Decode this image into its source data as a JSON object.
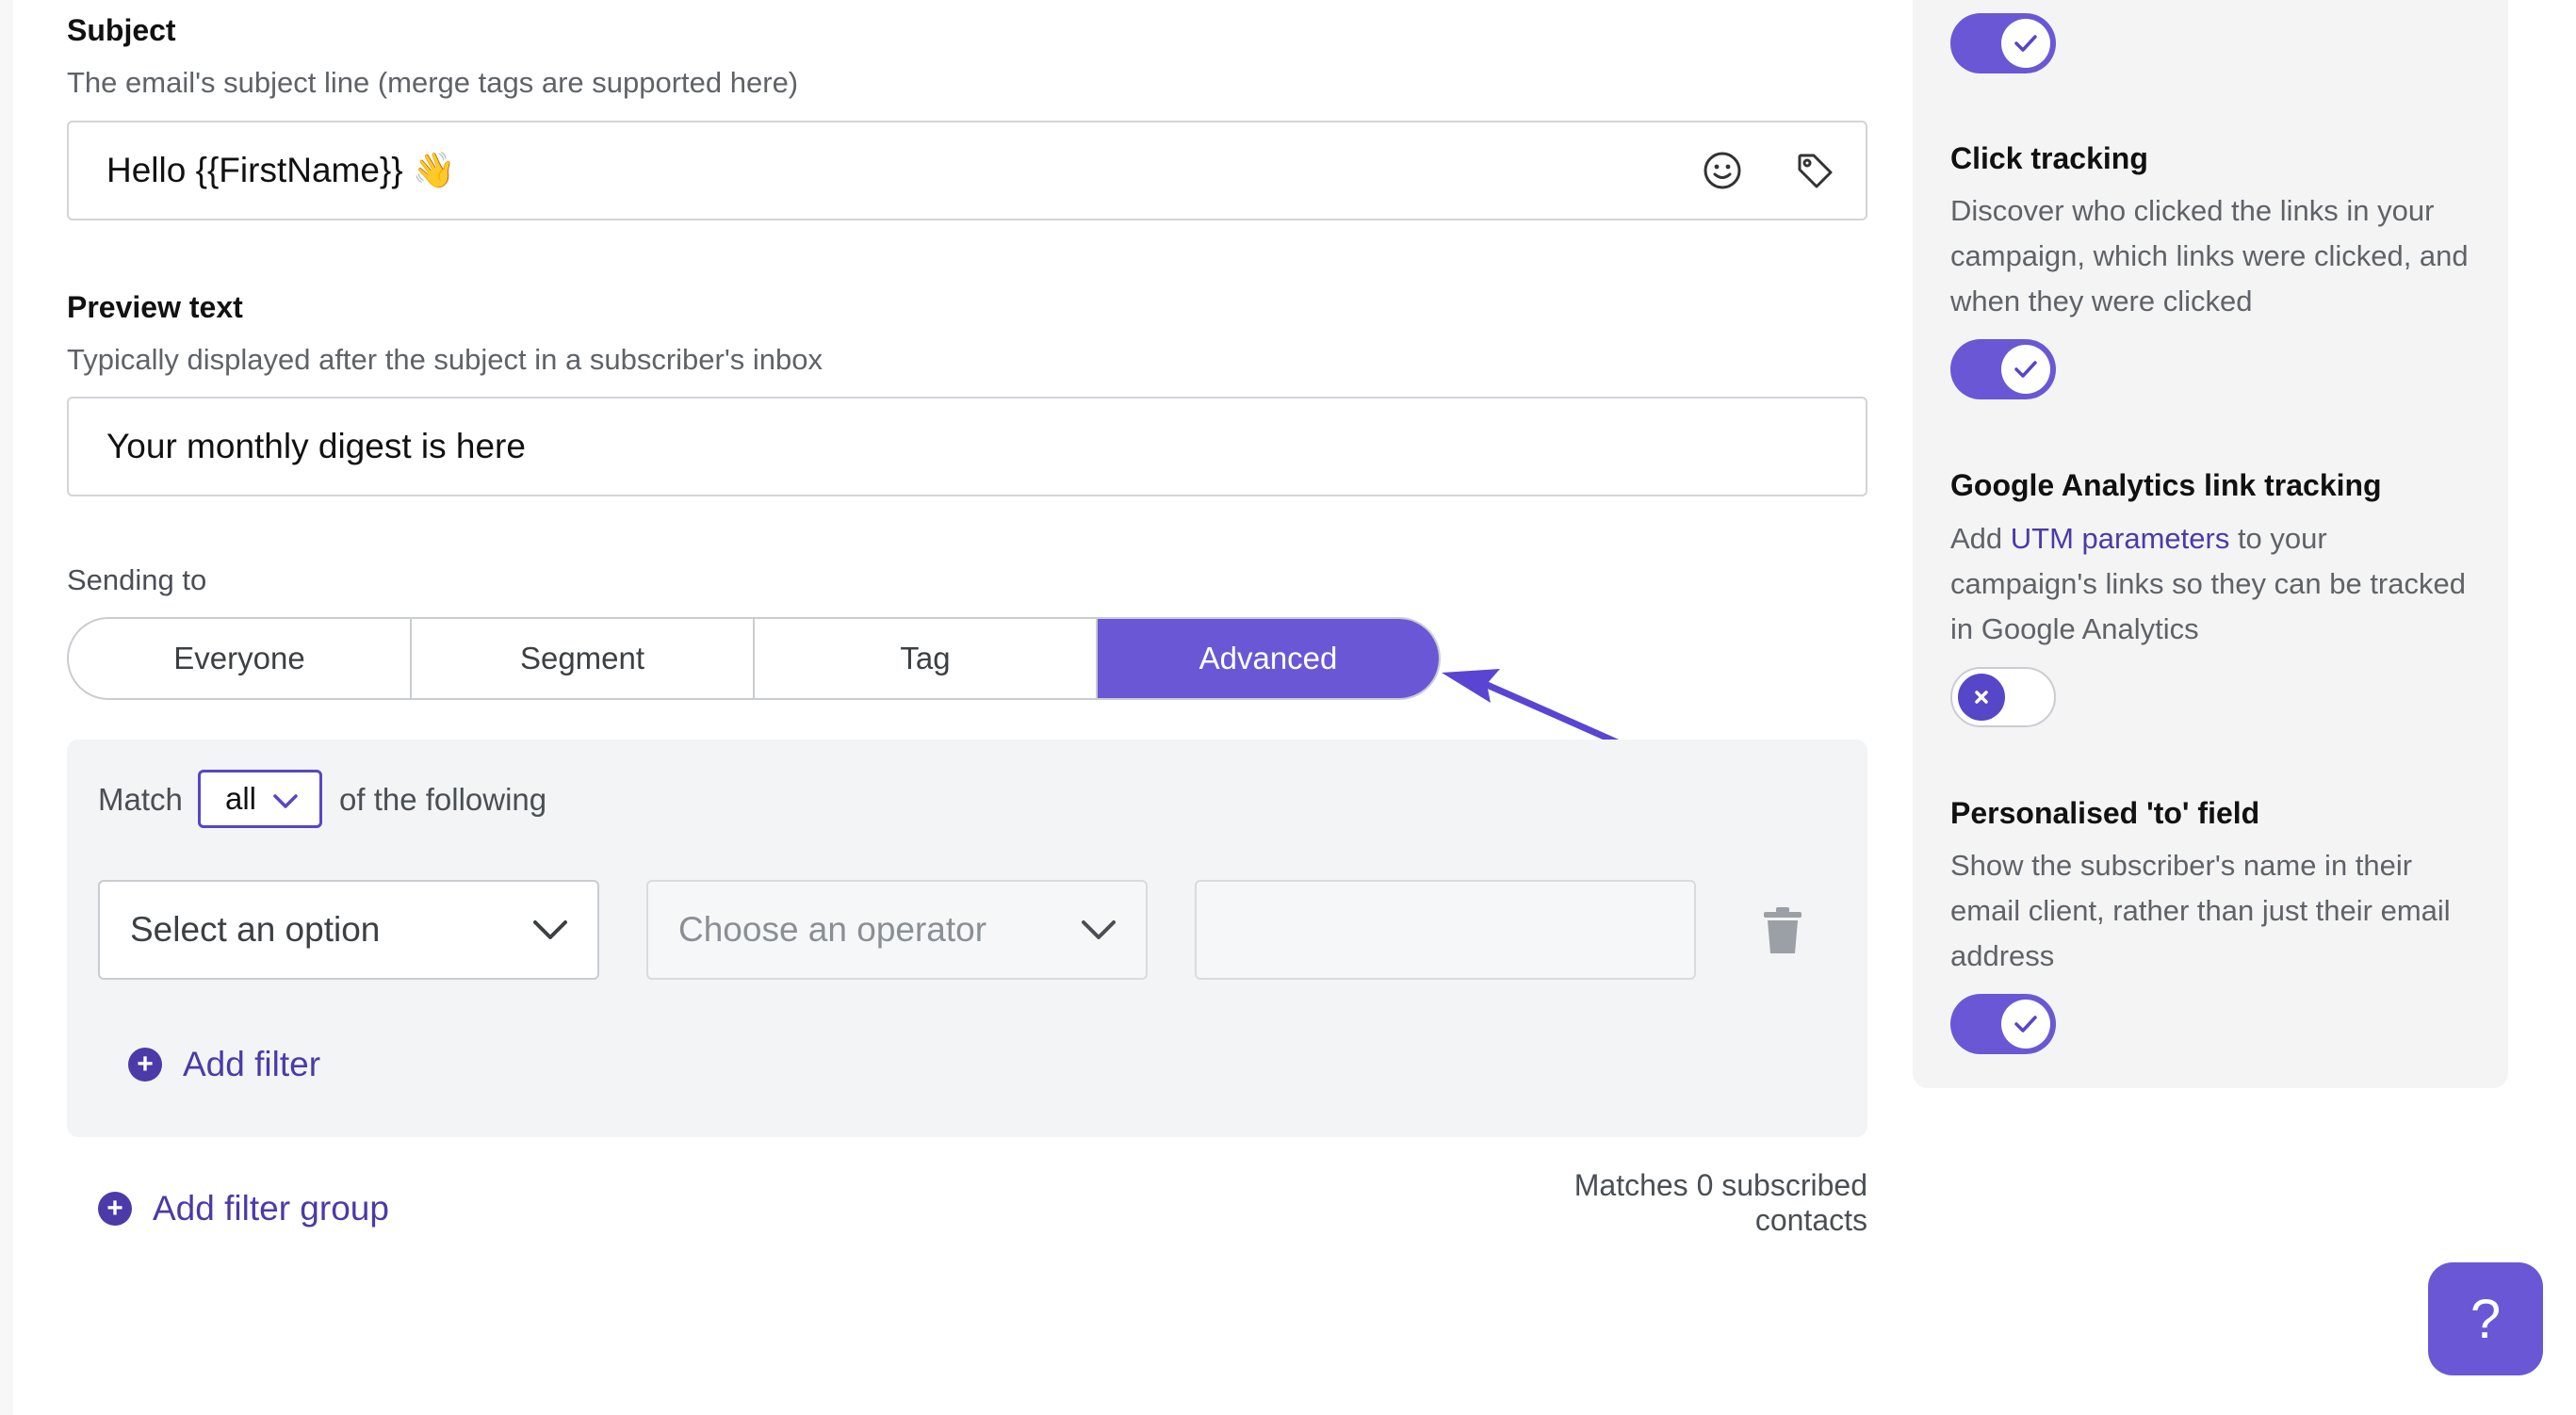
{
  "subject": {
    "label": "Subject",
    "help": "The email's subject line (merge tags are supported here)",
    "value": "Hello {{FirstName}} 👋",
    "icons": [
      "emoji-icon",
      "tag-icon"
    ]
  },
  "preview": {
    "label": "Preview text",
    "help": "Typically displayed after the subject in a subscriber's inbox",
    "value": "Your monthly digest is here"
  },
  "sending": {
    "label": "Sending to",
    "options": [
      "Everyone",
      "Segment",
      "Tag",
      "Advanced"
    ],
    "selected": "Advanced"
  },
  "filter": {
    "match_prefix": "Match",
    "match_value": "all",
    "match_suffix": "of the following",
    "option_placeholder": "Select an option",
    "operator_placeholder": "Choose an operator",
    "value": "",
    "add_filter": "Add filter",
    "add_filter_group": "Add filter group",
    "matches_text": "Matches 0 subscribed contacts"
  },
  "sidebar": {
    "top_toggle_on": true,
    "click_tracking": {
      "title": "Click tracking",
      "desc": "Discover who clicked the links in your campaign, which links were clicked, and when they were clicked",
      "on": true
    },
    "ga_tracking": {
      "title": "Google Analytics link tracking",
      "desc_prefix": "Add ",
      "desc_link": "UTM parameters",
      "desc_suffix": " to your campaign's links so they can be tracked in Google Analytics",
      "on": false
    },
    "personalised_to": {
      "title": "Personalised 'to' field",
      "desc": "Show the subscriber's name in their email client, rather than just their email address",
      "on": true
    }
  },
  "help_button": "?",
  "colors": {
    "accent": "#6a57d6",
    "link": "#4b3aa8",
    "arrow": "#5a44d4"
  }
}
